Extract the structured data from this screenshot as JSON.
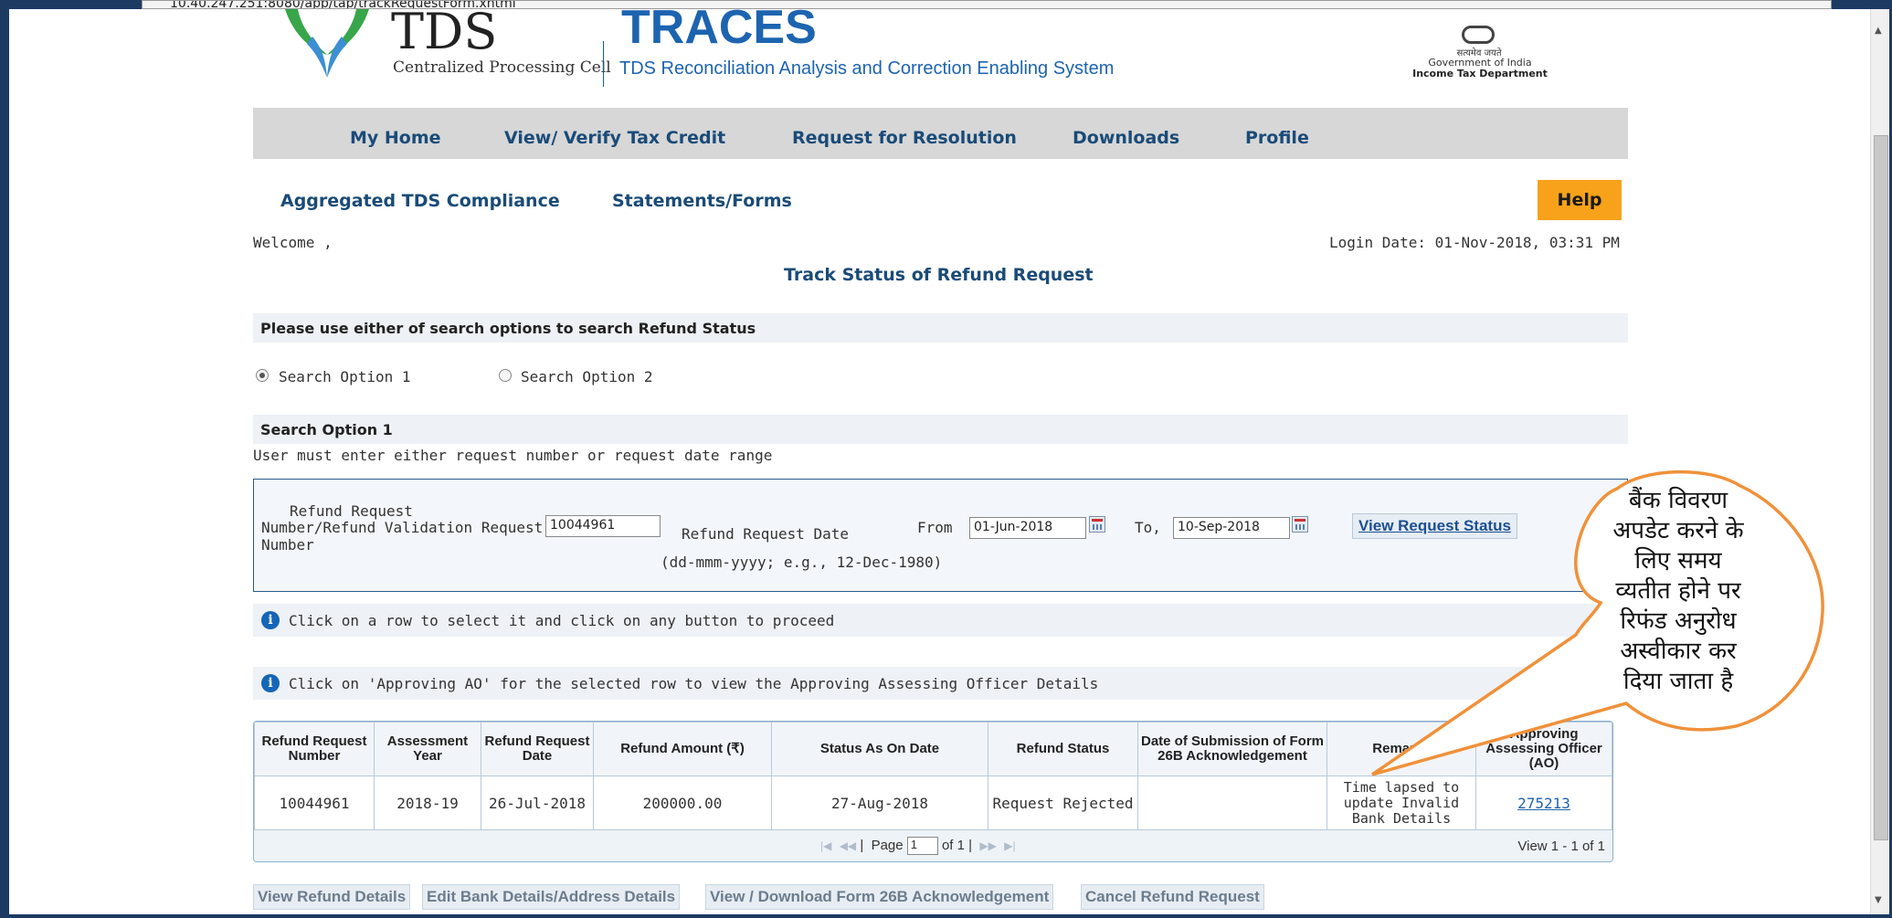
{
  "browser": {
    "url": "10.40.247.251:8080/app/tap/trackRequestForm.xhtml"
  },
  "header": {
    "tds_logo_text": "TDS",
    "cpc_text": "Centralized Processing Cell",
    "traces_title": "TRACES",
    "traces_subtitle": "TDS Reconciliation Analysis and Correction Enabling System",
    "gov_hindi": "सत्यमेव जयते",
    "gov_line1": "Government of India",
    "gov_line2": "Income Tax Department"
  },
  "menu": {
    "items": [
      "My Home",
      "View/ Verify Tax Credit",
      "Request for Resolution",
      "Downloads",
      "Profile"
    ],
    "sub_items": [
      "Aggregated TDS Compliance",
      "Statements/Forms"
    ],
    "help": "Help"
  },
  "welcome": "Welcome ,",
  "login_date": "Login Date: 01-Nov-2018, 03:31 PM",
  "page_title": "Track Status of Refund Request",
  "search": {
    "instruction": "Please use either of search options to search Refund Status",
    "option1_label": "Search Option 1",
    "option2_label": "Search Option 2",
    "selected": "Search Option 1",
    "section_title": "Search Option 1",
    "section_note": "User must enter either request number or request date range",
    "request_number_label_1": "Refund Request",
    "request_number_label_2": "Number/Refund Validation Request",
    "request_number_label_3": "Number",
    "request_number_value": "10044961",
    "date_label": "Refund Request Date",
    "date_format_hint": "(dd-mmm-yyyy; e.g., 12-Dec-1980)",
    "from_label": "From",
    "from_value": "01-Jun-2018",
    "to_label": "To,",
    "to_value": "10-Sep-2018",
    "view_button": "View Request Status"
  },
  "info": {
    "row_select": "Click on a row to select it and click on any button to proceed",
    "approving_ao": "Click on 'Approving AO' for the selected row to view the Approving Assessing Officer Details"
  },
  "table": {
    "headers": [
      "Refund Request Number",
      "Assessment Year",
      "Refund Request Date",
      "Refund Amount (₹)",
      "Status As On Date",
      "Refund Status",
      "Date of Submission of Form 26B Acknowledgement",
      "Remarks",
      "Approving Assessing Officer (AO)"
    ],
    "rows": [
      {
        "request_number": "10044961",
        "assessment_year": "2018-19",
        "request_date": "26-Jul-2018",
        "amount": "200000.00",
        "status_date": "27-Aug-2018",
        "status": "Request Rejected",
        "form26b_date": "",
        "remarks": "Time lapsed to update Invalid Bank Details",
        "approving_ao": "275213"
      }
    ],
    "pager": {
      "page_label": "Page",
      "page_value": "1",
      "of_label": "of 1",
      "view_count": "View 1 - 1 of 1"
    }
  },
  "actions": [
    "View Refund Details",
    "Edit Bank Details/Address Details",
    "View / Download Form 26B Acknowledgement",
    "Cancel Refund Request"
  ],
  "callout": {
    "text_lines": [
      "बैंक विवरण",
      "अपडेट करने के",
      "लिए समय",
      "व्यतीत होने पर",
      "रिफंड अनुरोध",
      "अस्वीकार कर",
      "दिया जाता है"
    ],
    "border_color": "#f0913a"
  },
  "colors": {
    "menu_bg": "#d7d7d7",
    "link_blue": "#1a4b78",
    "help_orange": "#f7a21a",
    "frame_navy": "#1d3a63"
  }
}
